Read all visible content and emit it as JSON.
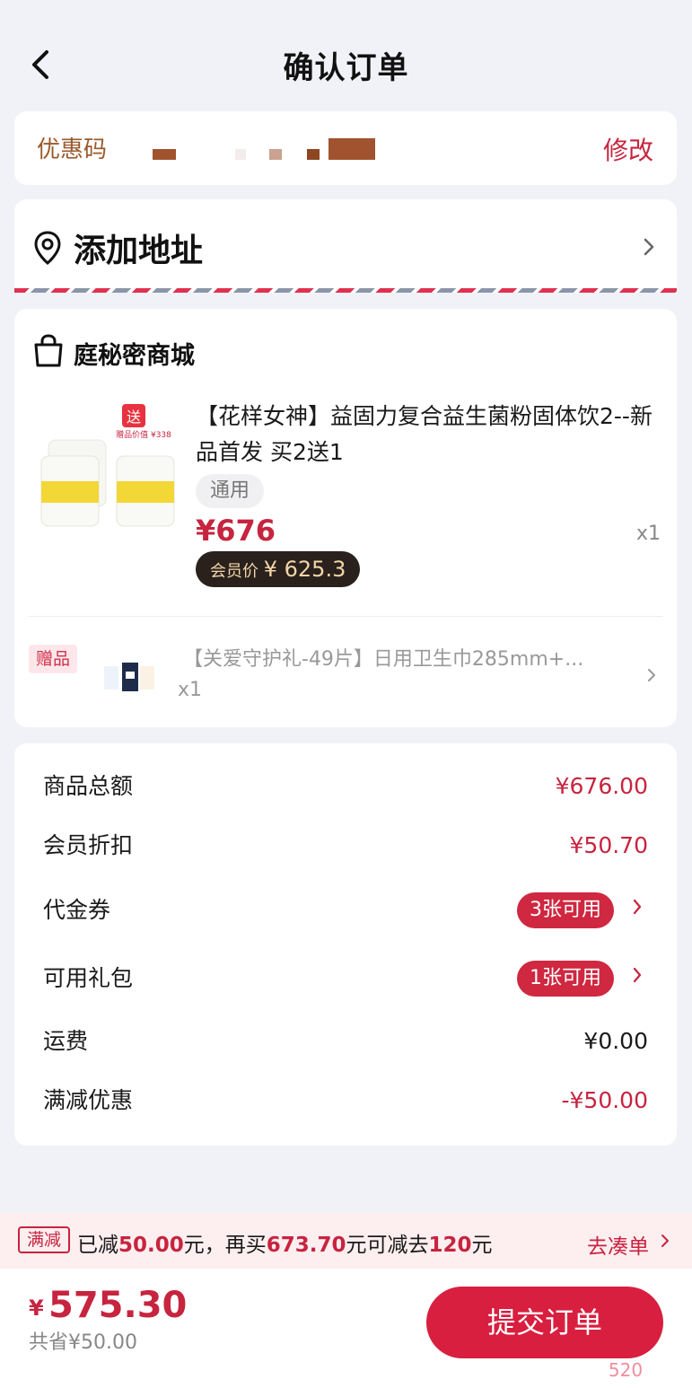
{
  "header": {
    "title": "确认订单"
  },
  "coupon": {
    "label": "优惠码",
    "edit_label": "修改"
  },
  "address": {
    "label": "添加地址"
  },
  "store": {
    "name": "庭秘密商城",
    "product": {
      "title": "【花样女神】益固力复合益生菌粉固体饮2--新品首发 买2送1",
      "tag": "通用",
      "price": "¥676",
      "quantity": "x1",
      "member_price_label": "会员价",
      "member_price_value": "¥ 625.3",
      "image_badge_text": "送",
      "image_badge_subtext": "赠品价值 ¥338"
    },
    "gift": {
      "tag": "赠品",
      "title": "【关爱守护礼-49片】日用卫生巾285mm+...",
      "quantity": "x1"
    }
  },
  "summary": {
    "goods_total_label": "商品总额",
    "goods_total_value": "¥676.00",
    "member_discount_label": "会员折扣",
    "member_discount_value": "¥50.70",
    "voucher_label": "代金券",
    "voucher_badge": "3张可用",
    "gift_pack_label": "可用礼包",
    "gift_pack_badge": "1张可用",
    "shipping_label": "运费",
    "shipping_value": "¥0.00",
    "full_reduction_label": "满减优惠",
    "full_reduction_value": "-¥50.00"
  },
  "promo": {
    "tag": "满减",
    "text_1": "已减",
    "reduced": "50.00",
    "text_2": "元，再买",
    "need_more": "673.70",
    "text_3": "元可减去",
    "next_reduction": "120",
    "text_4": "元",
    "link": "去凑单"
  },
  "footer": {
    "currency": "¥",
    "total": "575.30",
    "saved": "共省¥50.00",
    "submit_label": "提交订单",
    "watermark": "520"
  },
  "colors": {
    "accent": "#c7243f",
    "button": "#d81f3f",
    "background": "#f1f2f7",
    "coupon_label": "#9a5a2c",
    "member_badge_bg": "#2a211d",
    "member_badge_text": "#f1d6a8"
  },
  "icons": [
    "back-arrow-icon",
    "location-pin-icon",
    "chevron-right-icon",
    "shopping-bag-icon"
  ]
}
